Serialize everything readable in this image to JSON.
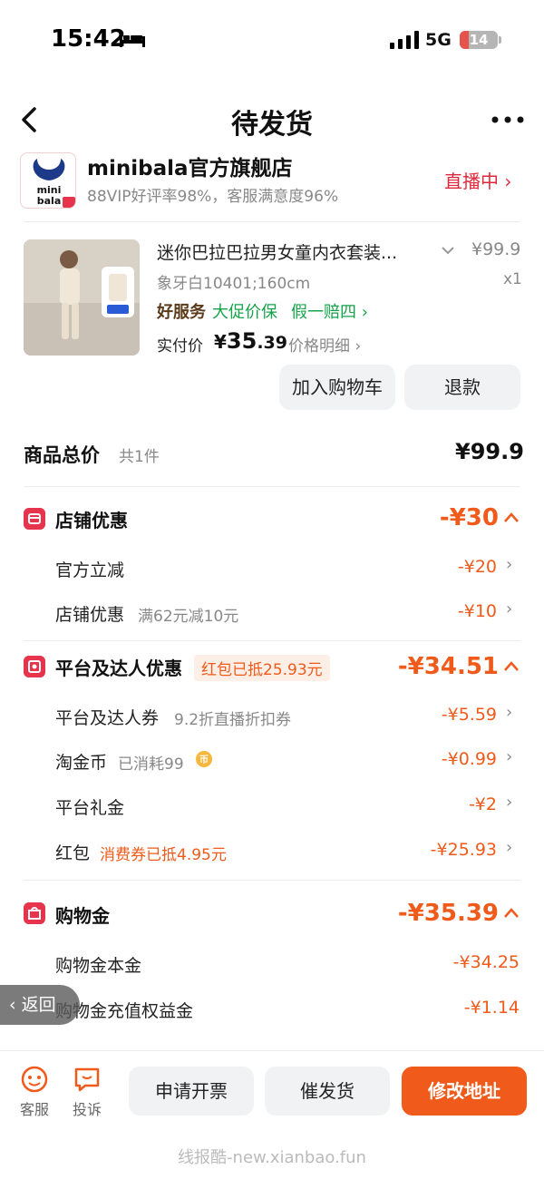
{
  "status_bar": {
    "time": "15:42",
    "network": "5G",
    "battery": "14"
  },
  "nav": {
    "title": "待发货"
  },
  "store": {
    "logo_text": "mini\nbala",
    "name": "minibala官方旗舰店",
    "stats": "88VIP好评率98%，客服满意度96%",
    "live_label": "直播中"
  },
  "product": {
    "title": "迷你巴拉巴拉男女童内衣套装...",
    "price": "¥99.9",
    "spec": "象牙白10401;160cm",
    "qty": "x1",
    "tag_good_service": "好服务",
    "tag_protect": "大促价保",
    "tag_fake": "假一赔四",
    "paid_label": "实付价",
    "paid_currency": "¥",
    "paid_int": "35",
    "paid_dec": ".39",
    "price_detail": "价格明细",
    "add_cart": "加入购物车",
    "refund": "退款"
  },
  "totals": {
    "label": "商品总价",
    "count": "共1件",
    "value": "¥99.9"
  },
  "shop_discount": {
    "title": "店铺优惠",
    "amount": "-¥30",
    "rows": [
      {
        "label": "官方立减",
        "sub": "",
        "amount": "-¥20"
      },
      {
        "label": "店铺优惠",
        "sub": "满62元减10元",
        "amount": "-¥10"
      }
    ]
  },
  "platform_discount": {
    "title": "平台及达人优惠",
    "badge": "红包已抵25.93元",
    "amount": "-¥34.51",
    "rows": [
      {
        "label": "平台及达人券",
        "sub": "9.2折直播折扣券",
        "amount": "-¥5.59"
      },
      {
        "label": "淘金币",
        "sub": "已消耗99",
        "amount": "-¥0.99"
      },
      {
        "label": "平台礼金",
        "sub": "",
        "amount": "-¥2"
      },
      {
        "label": "红包",
        "sub": "消费券已抵4.95元",
        "amount": "-¥25.93"
      }
    ]
  },
  "shopping_gold": {
    "title": "购物金",
    "amount": "-¥35.39",
    "rows": [
      {
        "label": "购物金本金",
        "amount": "-¥34.25"
      },
      {
        "label": "购物金充值权益金",
        "amount": "-¥1.14"
      }
    ]
  },
  "back_overlay": "返回",
  "bottom": {
    "service": "客服",
    "complaint": "投诉",
    "invoice": "申请开票",
    "urge": "催发货",
    "change_address": "修改地址"
  },
  "watermark": "线报酷-new.xianbao.fun",
  "colors": {
    "accent_orange": "#f05a1a",
    "accent_red": "#e5344b",
    "green": "#16a34a",
    "gray_button": "#f1f2f4"
  }
}
